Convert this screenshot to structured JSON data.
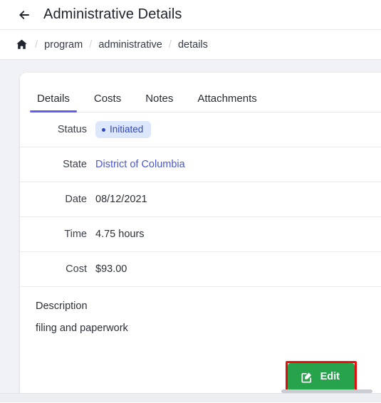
{
  "header": {
    "back_icon": "back-arrow-icon",
    "title": "Administrative Details"
  },
  "breadcrumb": {
    "home_icon": "home-icon",
    "separator": "/",
    "items": [
      {
        "label": "program"
      },
      {
        "label": "administrative"
      },
      {
        "label": "details"
      }
    ]
  },
  "card": {
    "tabs": [
      {
        "label": "Details",
        "active": true
      },
      {
        "label": "Costs",
        "active": false
      },
      {
        "label": "Notes",
        "active": false
      },
      {
        "label": "Attachments",
        "active": false
      }
    ],
    "rows": [
      {
        "label": "Status",
        "value": "Initiated",
        "type": "badge"
      },
      {
        "label": "State",
        "value": "District of Columbia",
        "type": "link"
      },
      {
        "label": "Date",
        "value": "08/12/2021",
        "type": "text"
      },
      {
        "label": "Time",
        "value": "4.75 hours",
        "type": "text"
      },
      {
        "label": "Cost",
        "value": "$93.00",
        "type": "text"
      }
    ],
    "description": {
      "title": "Description",
      "text": "filing and paperwork"
    },
    "edit_button": {
      "label": "Edit",
      "icon": "edit-pencil-square-icon"
    }
  },
  "colors": {
    "tab_active_underline": "#625cf4",
    "badge_background": "#dce7fb",
    "badge_text": "#2e46c8",
    "link_text": "#4b57d6",
    "edit_button_background": "#27a34b",
    "highlight_border": "#f40d0d",
    "page_background": "#f1f2f5"
  }
}
